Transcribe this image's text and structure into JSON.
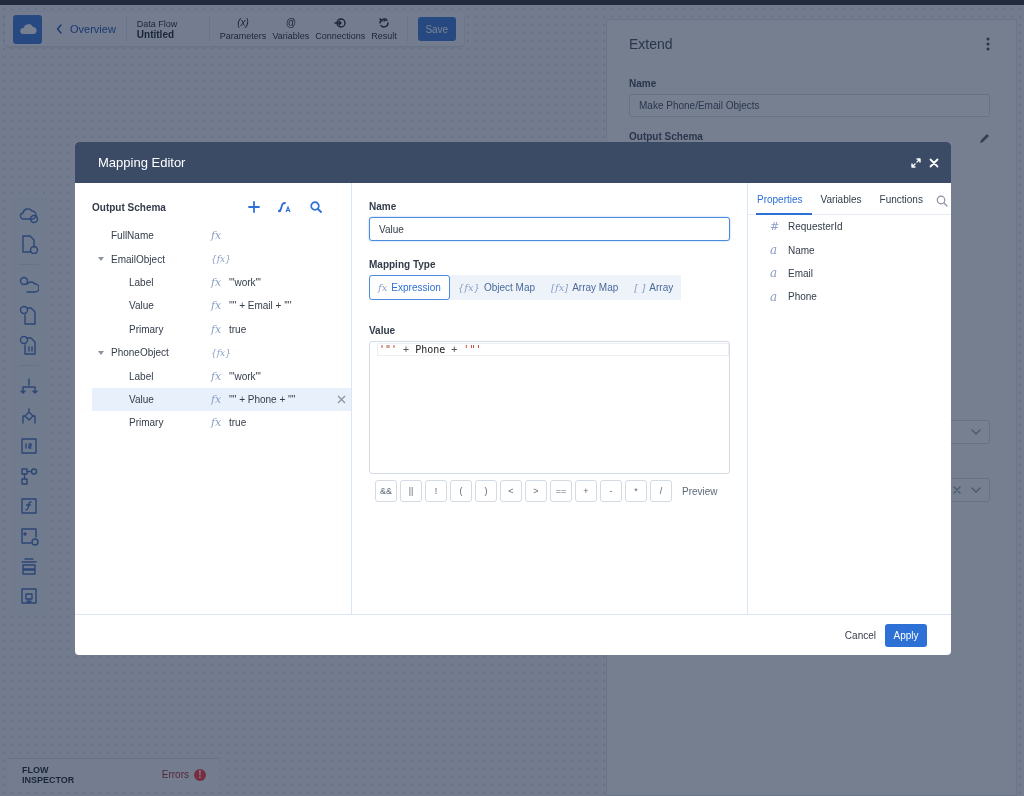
{
  "app_bar": {
    "back_link": "Overview",
    "flow_type": "Data Flow",
    "flow_name": "Untitled",
    "tools": [
      {
        "kind": "text",
        "symbol": "(x)",
        "label": "Parameters"
      },
      {
        "kind": "text",
        "symbol": "@",
        "label": "Variables"
      },
      {
        "kind": "connections",
        "label": "Connections"
      },
      {
        "kind": "result",
        "label": "Result"
      }
    ],
    "save_button": "Save"
  },
  "inspector_panel": {
    "title": "Extend",
    "name_label": "Name",
    "name_value": "Make Phone/Email Objects",
    "output_schema_label": "Output Schema"
  },
  "flow_inspector": {
    "label": "FLOW INSPECTOR",
    "errors_label": "Errors",
    "errors_badge": "!"
  },
  "mapping_editor": {
    "title": "Mapping Editor",
    "output_schema": {
      "title": "Output Schema",
      "items": [
        {
          "name": "FullName",
          "kind": "expression",
          "symbol": "fx",
          "selected": false
        },
        {
          "name": "EmailObject",
          "kind": "object",
          "symbol": "{fx}",
          "expanded": true,
          "selected": false,
          "children": [
            {
              "name": "Label",
              "kind": "expression",
              "symbol": "fx",
              "expression": "'\"work\"'",
              "selected": false
            },
            {
              "name": "Value",
              "kind": "expression",
              "symbol": "fx",
              "expression": "'\"' + Email + '\"'",
              "selected": false
            },
            {
              "name": "Primary",
              "kind": "expression",
              "symbol": "fx",
              "expression": "true",
              "selected": false
            }
          ]
        },
        {
          "name": "PhoneObject",
          "kind": "object",
          "symbol": "{fx}",
          "expanded": true,
          "selected": false,
          "children": [
            {
              "name": "Label",
              "kind": "expression",
              "symbol": "fx",
              "expression": "'\"work\"'",
              "selected": false
            },
            {
              "name": "Value",
              "kind": "expression",
              "symbol": "fx",
              "expression": "'\"' + Phone + '\"'",
              "selected": true
            },
            {
              "name": "Primary",
              "kind": "expression",
              "symbol": "fx",
              "expression": "true",
              "selected": false
            }
          ]
        }
      ]
    },
    "name_label": "Name",
    "name_value": "Value",
    "mapping_type_label": "Mapping Type",
    "mapping_types": [
      {
        "symbol": "fx",
        "label": "Expression",
        "selected": true
      },
      {
        "symbol": "{fx}",
        "label": "Object Map",
        "selected": false
      },
      {
        "symbol": "[fx]",
        "label": "Array Map",
        "selected": false
      },
      {
        "symbol": "[ ]",
        "label": "Array",
        "selected": false
      }
    ],
    "value_label": "Value",
    "code": [
      {
        "kind": "string",
        "text": "'\"'"
      },
      {
        "kind": "operator",
        "text": "+"
      },
      {
        "kind": "identifier",
        "text": "Phone"
      },
      {
        "kind": "operator",
        "text": "+"
      },
      {
        "kind": "string",
        "text": "'\"'"
      }
    ],
    "operators": [
      "&&",
      "||",
      "!",
      "(",
      ")",
      "<",
      ">",
      "==",
      "+",
      "-",
      "*",
      "/"
    ],
    "preview_button": "Preview",
    "tabs": [
      {
        "label": "Properties",
        "selected": true
      },
      {
        "label": "Variables",
        "selected": false
      },
      {
        "label": "Functions",
        "selected": false
      }
    ],
    "properties": [
      {
        "kind": "number",
        "symbol": "#",
        "name": "RequesterId"
      },
      {
        "kind": "text",
        "symbol": "a",
        "name": "Name"
      },
      {
        "kind": "text",
        "symbol": "a",
        "name": "Email"
      },
      {
        "kind": "text",
        "symbol": "a",
        "name": "Phone"
      }
    ],
    "cancel_button": "Cancel",
    "apply_button": "Apply"
  }
}
